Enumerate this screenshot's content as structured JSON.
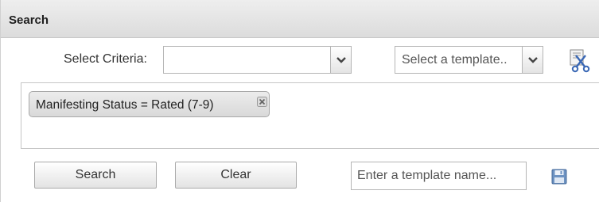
{
  "header": {
    "title": "Search"
  },
  "criteria": {
    "label": "Select Criteria:",
    "value": "",
    "dropdown_icon": "chevron-down-icon"
  },
  "template_select": {
    "value": "Select a template..",
    "dropdown_icon": "chevron-down-icon"
  },
  "clear_criteria_icon": "scissors-document-icon",
  "chips": [
    {
      "label": "Manifesting Status = Rated (7-9)",
      "remove_icon": "close-icon"
    }
  ],
  "actions": {
    "search_label": "Search",
    "clear_label": "Clear"
  },
  "template_name": {
    "value": "",
    "placeholder": "Enter a template name..."
  },
  "save_icon": "floppy-disk-icon",
  "colors": {
    "header_bg": "#e3e3e3",
    "chip_bg": "#e2e2e2",
    "save_icon": "#5b87b8",
    "scissors_icon": "#3a68b5"
  }
}
